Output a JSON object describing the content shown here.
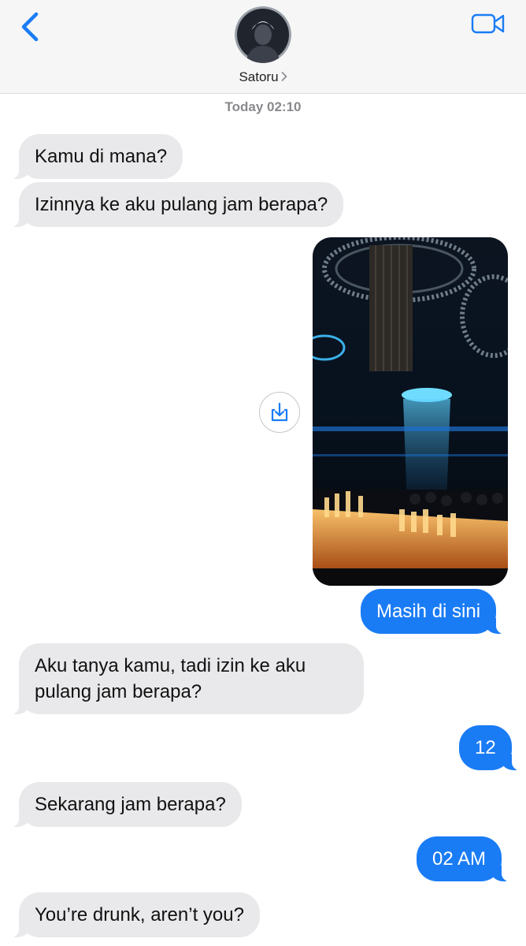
{
  "header": {
    "contact_name": "Satoru",
    "icons": [
      "chevron-left-icon",
      "video-camera-icon"
    ],
    "accent_color": "#1a7cf5"
  },
  "conversation": {
    "timestamp": "Today 02:10",
    "messages": [
      {
        "side": "incoming",
        "text": "Kamu di mana?"
      },
      {
        "side": "incoming",
        "text": "Izinnya ke aku pulang jam berapa?"
      },
      {
        "side": "outgoing",
        "type": "image"
      },
      {
        "side": "outgoing",
        "text": "Masih di sini"
      },
      {
        "side": "incoming",
        "text_line1": "Aku tanya kamu, tadi izin ke aku",
        "text_line2": "pulang jam berapa?"
      },
      {
        "side": "outgoing",
        "text": "12"
      },
      {
        "side": "incoming",
        "text": "Sekarang jam berapa?"
      },
      {
        "side": "outgoing",
        "text": "02 AM"
      },
      {
        "side": "incoming",
        "text": "You’re drunk, aren’t you?"
      }
    ]
  },
  "colors": {
    "outgoing_bubble": "#1a7cf5",
    "incoming_bubble": "#e9e9eb",
    "timestamp": "#8a8a8e"
  }
}
